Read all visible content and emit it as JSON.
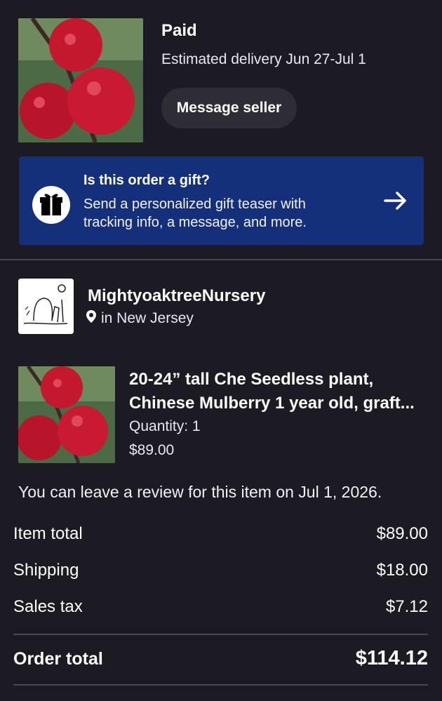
{
  "order": {
    "status": "Paid",
    "delivery": "Estimated delivery Jun 27-Jul 1",
    "message_seller": "Message seller"
  },
  "gift": {
    "title": "Is this order a gift?",
    "body": "Send a personalized gift teaser with tracking info, a message, and more.",
    "icon": "gift-icon",
    "arrow": "arrow-right-icon"
  },
  "seller": {
    "name": "MightyoaktreeNursery",
    "location": "in New Jersey"
  },
  "item": {
    "title": "20-24” tall Che Seedless plant, Chinese Mulberry 1 year old, graft...",
    "quantity": "Quantity: 1",
    "price": "$89.00"
  },
  "review_note": "You can leave a review for this item on Jul 1, 2026.",
  "summary": {
    "rows": [
      {
        "label": "Item total",
        "value": "$89.00"
      },
      {
        "label": "Shipping",
        "value": "$18.00"
      },
      {
        "label": "Sales tax",
        "value": "$7.12"
      }
    ],
    "total_label": "Order total",
    "total_value": "$114.12"
  },
  "colors": {
    "background": "#1c1a22",
    "gift_banner": "#14307a",
    "button": "#2e2c35",
    "fruit": "#c4182f"
  }
}
